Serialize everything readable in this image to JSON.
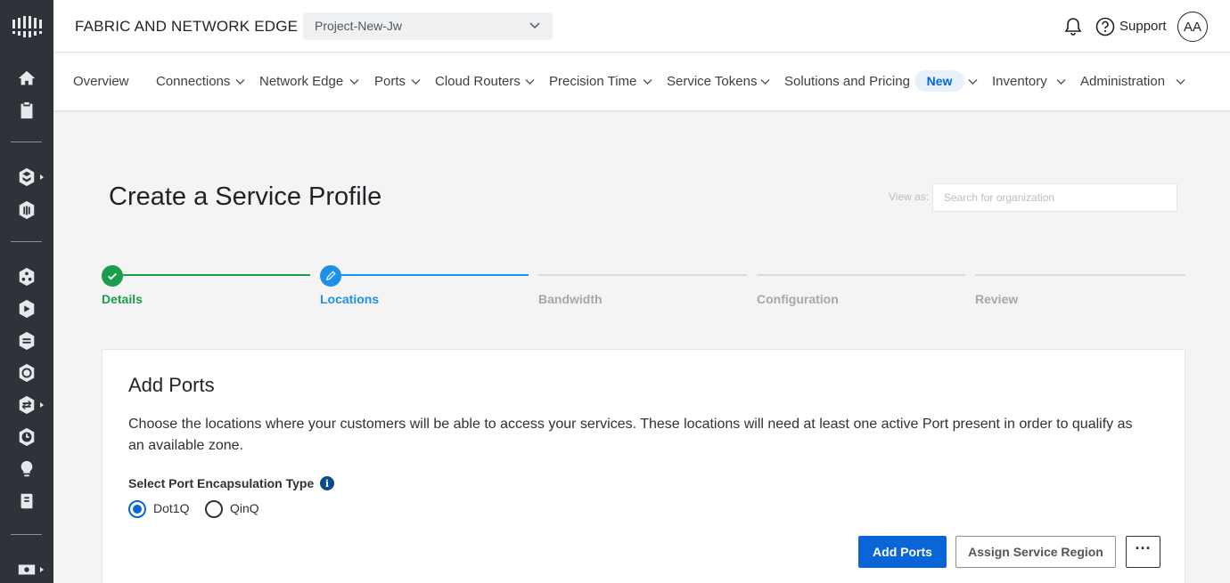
{
  "app": {
    "title": "FABRIC AND NETWORK EDGE",
    "project": "Project-New-Jw",
    "support_label": "Support",
    "avatar_initials": "AA"
  },
  "rail": {
    "icons": [
      "brand-logo-icon",
      "home-icon",
      "clipboard-icon",
      "layers-icon",
      "building-icon",
      "hexagon-network-icon",
      "router-icon",
      "stack-icon",
      "globe-icon",
      "swap-icon",
      "clock-icon",
      "lightbulb-icon",
      "book-icon",
      "billing-icon"
    ]
  },
  "nav": {
    "items": [
      {
        "label": "Overview"
      },
      {
        "label": "Connections"
      },
      {
        "label": "Network Edge"
      },
      {
        "label": "Ports"
      },
      {
        "label": "Cloud Routers"
      },
      {
        "label": "Precision Time"
      },
      {
        "label": "Service Tokens"
      },
      {
        "label": "Solutions and Pricing"
      },
      {
        "label": "Inventory"
      },
      {
        "label": "Administration"
      }
    ],
    "new_badge": "New"
  },
  "page": {
    "title": "Create a Service Profile",
    "view_as_label": "View as:",
    "org_search_placeholder": "Search for organization"
  },
  "stepper": {
    "steps": [
      {
        "label": "Details",
        "state": "complete"
      },
      {
        "label": "Locations",
        "state": "active"
      },
      {
        "label": "Bandwidth",
        "state": "pending"
      },
      {
        "label": "Configuration",
        "state": "pending"
      },
      {
        "label": "Review",
        "state": "pending"
      }
    ]
  },
  "card": {
    "title": "Add Ports",
    "description": "Choose the locations where your customers will be able to access your services. These locations will need at least one active Port present in order to qualify as an available zone.",
    "encap_label": "Select Port Encapsulation Type",
    "encap_options": [
      {
        "label": "Dot1Q",
        "selected": true
      },
      {
        "label": "QinQ",
        "selected": false
      }
    ],
    "add_ports_button": "Add Ports",
    "assign_region_button": "Assign Service Region",
    "more_button": "···"
  },
  "colors": {
    "rail_bg": "#2f3339",
    "accent_blue": "#0a66d6",
    "step_complete": "#1a9e4b",
    "step_active": "#1e90e8",
    "step_pending": "#d9dbdf"
  }
}
